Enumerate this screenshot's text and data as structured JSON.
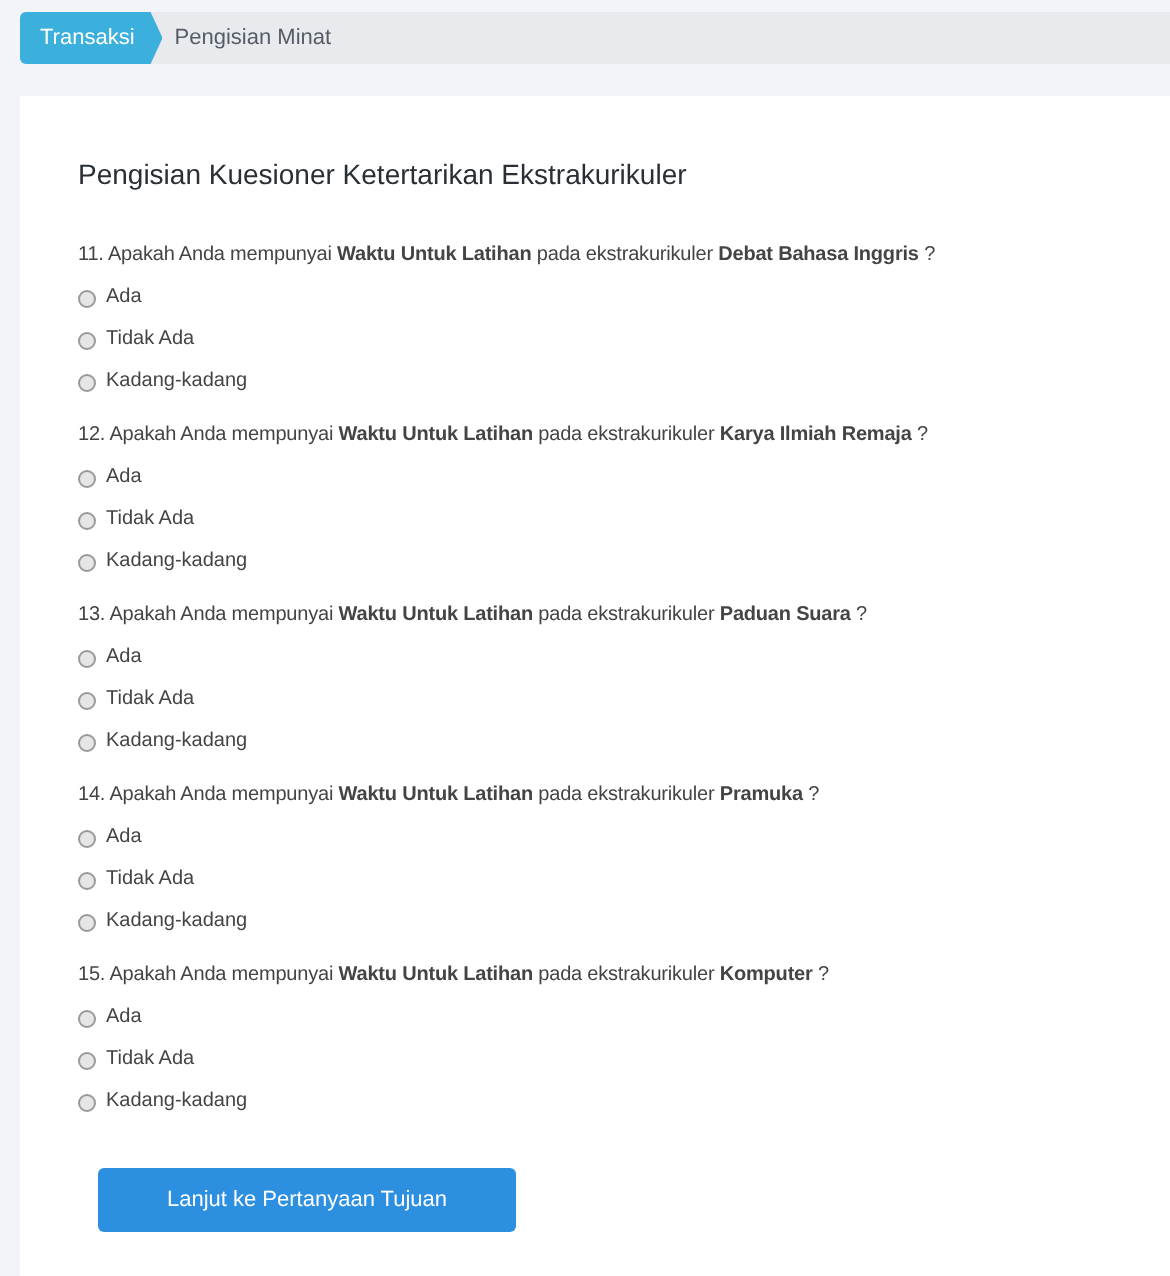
{
  "breadcrumb": [
    {
      "label": "Transaksi",
      "selected": true
    },
    {
      "label": "Pengisian Minat",
      "selected": false
    }
  ],
  "title": "Pengisian Kuesioner Ketertarikan Ekstrakurikuler",
  "questions": [
    {
      "text": "11. Apakah Anda mempunyai **Waktu Untuk Latihan** pada ekstrakurikuler **Debat Bahasa Inggris** ?",
      "options": [
        {
          "label": "Ada",
          "selected": false
        },
        {
          "label": "Tidak Ada",
          "selected": false
        },
        {
          "label": "Kadang-kadang",
          "selected": false
        }
      ]
    },
    {
      "text": "12. Apakah Anda mempunyai **Waktu Untuk Latihan** pada ekstrakurikuler **Karya Ilmiah Remaja** ?",
      "options": [
        {
          "label": "Ada",
          "selected": false
        },
        {
          "label": "Tidak Ada",
          "selected": false
        },
        {
          "label": "Kadang-kadang",
          "selected": false
        }
      ]
    },
    {
      "text": "13. Apakah Anda mempunyai **Waktu Untuk Latihan** pada ekstrakurikuler **Paduan Suara** ?",
      "options": [
        {
          "label": "Ada",
          "selected": false
        },
        {
          "label": "Tidak Ada",
          "selected": false
        },
        {
          "label": "Kadang-kadang",
          "selected": false
        }
      ]
    },
    {
      "text": "14. Apakah Anda mempunyai **Waktu Untuk Latihan** pada ekstrakurikuler **Pramuka** ?",
      "options": [
        {
          "label": "Ada",
          "selected": false
        },
        {
          "label": "Tidak Ada",
          "selected": false
        },
        {
          "label": "Kadang-kadang",
          "selected": false
        }
      ]
    },
    {
      "text": "15. Apakah Anda mempunyai **Waktu Untuk Latihan** pada ekstrakurikuler **Komputer** ?",
      "options": [
        {
          "label": "Ada",
          "selected": false
        },
        {
          "label": "Tidak Ada",
          "selected": false
        },
        {
          "label": "Kadang-kadang",
          "selected": false
        }
      ]
    }
  ],
  "button": "Lanjut ke Pertanyaan Tujuan"
}
